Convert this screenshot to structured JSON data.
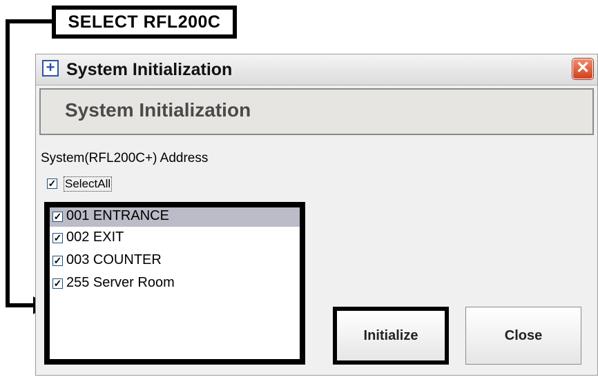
{
  "callout": {
    "label": "SELECT RFL200C"
  },
  "window": {
    "title": "System Initialization",
    "icon_glyph": "+",
    "close_glyph": "✕",
    "banner_title": "System Initialization",
    "address_label": "System(RFL200C+) Address",
    "select_all": {
      "label": "SelectAll",
      "checked": true
    },
    "list": [
      {
        "label": "001 ENTRANCE",
        "checked": true,
        "selected": true
      },
      {
        "label": "002 EXIT",
        "checked": true,
        "selected": false
      },
      {
        "label": "003 COUNTER",
        "checked": true,
        "selected": false
      },
      {
        "label": "255 Server Room",
        "checked": true,
        "selected": false
      }
    ],
    "buttons": {
      "initialize": "Initialize",
      "close": "Close"
    }
  },
  "colors": {
    "close_button": "#d2401e",
    "selected_row": "#bcbcc8",
    "icon_accent": "#2d52a8"
  },
  "icons": {
    "title_icon": "plus-square-icon",
    "close_icon": "close-icon",
    "arrow": "arrow-right-icon"
  }
}
